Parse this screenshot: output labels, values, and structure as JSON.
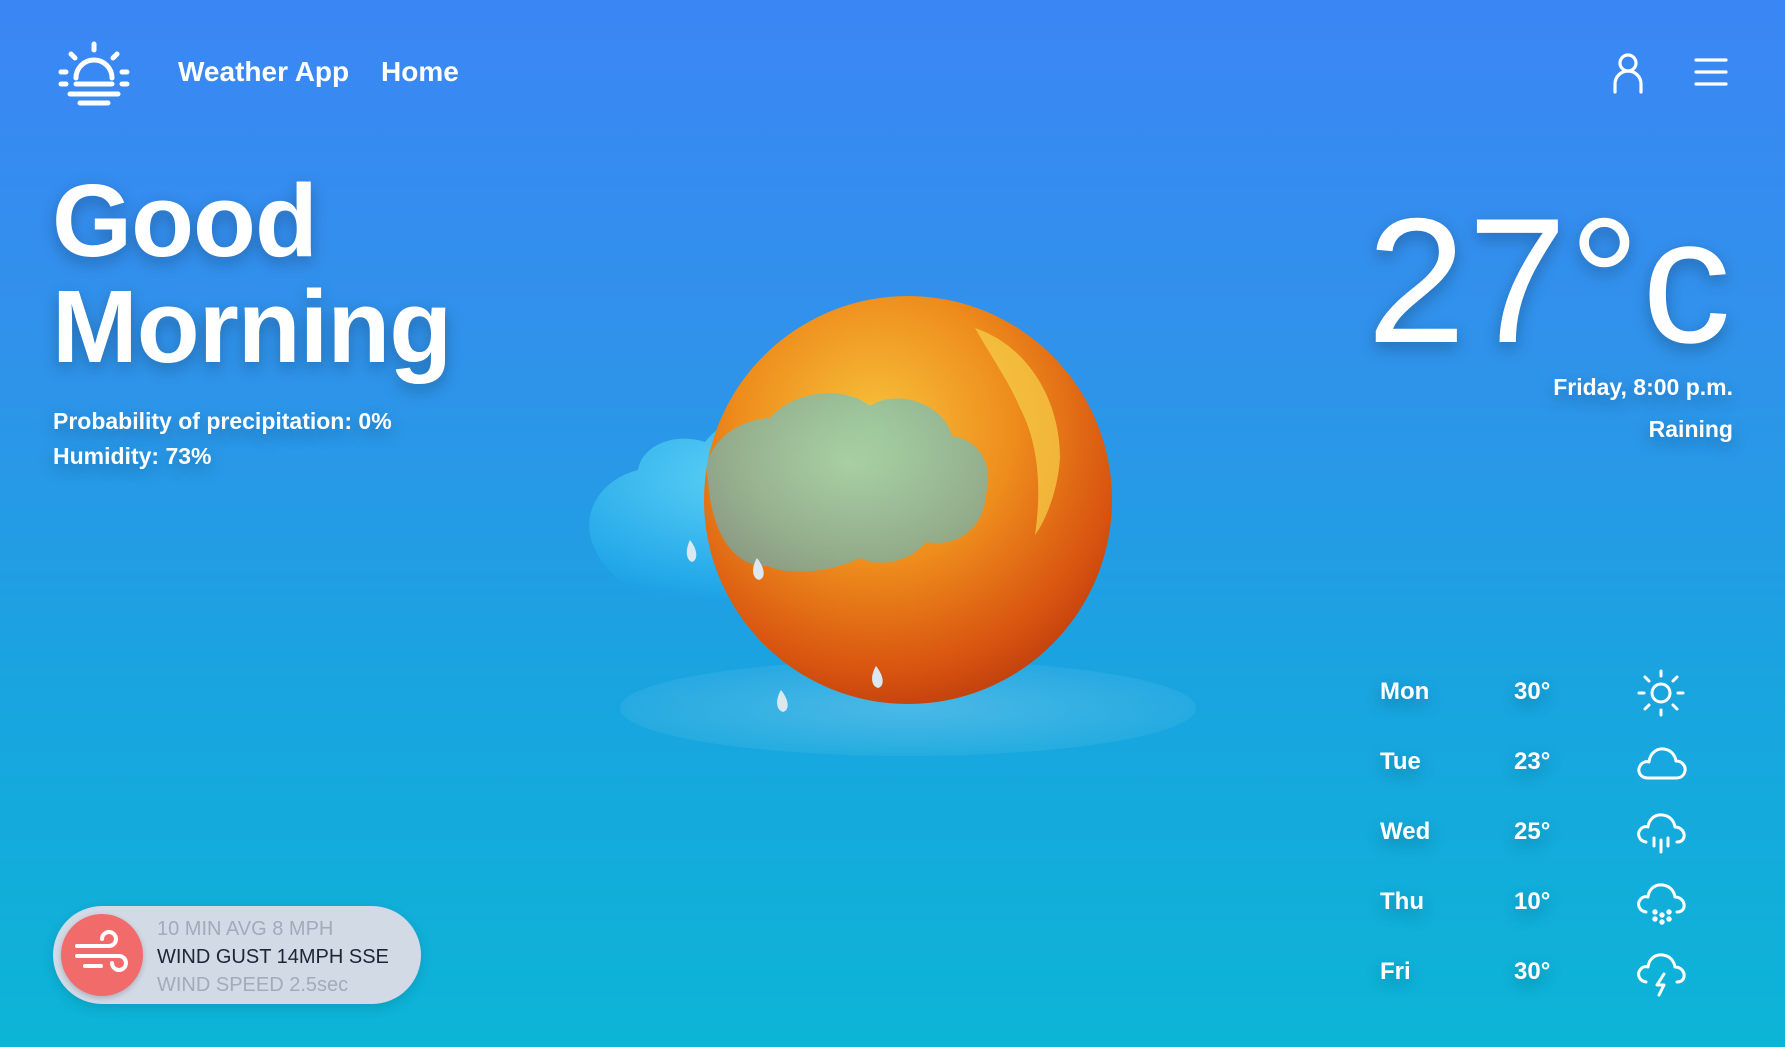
{
  "header": {
    "app_name": "Weather App",
    "nav_home": "Home",
    "icons": [
      "sunrise-icon",
      "user-icon",
      "hamburger-menu-icon"
    ]
  },
  "greeting": {
    "line1": "Good",
    "line2": "Morning"
  },
  "stats": {
    "precipitation": "Probability of precipitation: 0%",
    "humidity": "Humidity: 73%"
  },
  "current": {
    "temperature": "27°c",
    "datetime": "Friday, 8:00 p.m.",
    "condition": "Raining"
  },
  "forecast": [
    {
      "day": "Mon",
      "temp": "30°",
      "icon": "sun-icon"
    },
    {
      "day": "Tue",
      "temp": "23°",
      "icon": "cloud-icon"
    },
    {
      "day": "Wed",
      "temp": "25°",
      "icon": "cloud-rain-icon"
    },
    {
      "day": "Thu",
      "temp": "10°",
      "icon": "cloud-drizzle-icon"
    },
    {
      "day": "Fri",
      "temp": "30°",
      "icon": "cloud-lightning-icon"
    }
  ],
  "wind": {
    "avg": "10 MIN AVG 8 MPH",
    "gust": "WIND GUST 14MPH SSE",
    "speed": "WIND SPEED 2.5sec",
    "icon": "wind-icon"
  },
  "colors": {
    "bg_top": "#3b86f5",
    "bg_bottom": "#0cb5d6",
    "wind_badge": "#f26b6b",
    "wind_widget_bg": "#d2dae6"
  }
}
